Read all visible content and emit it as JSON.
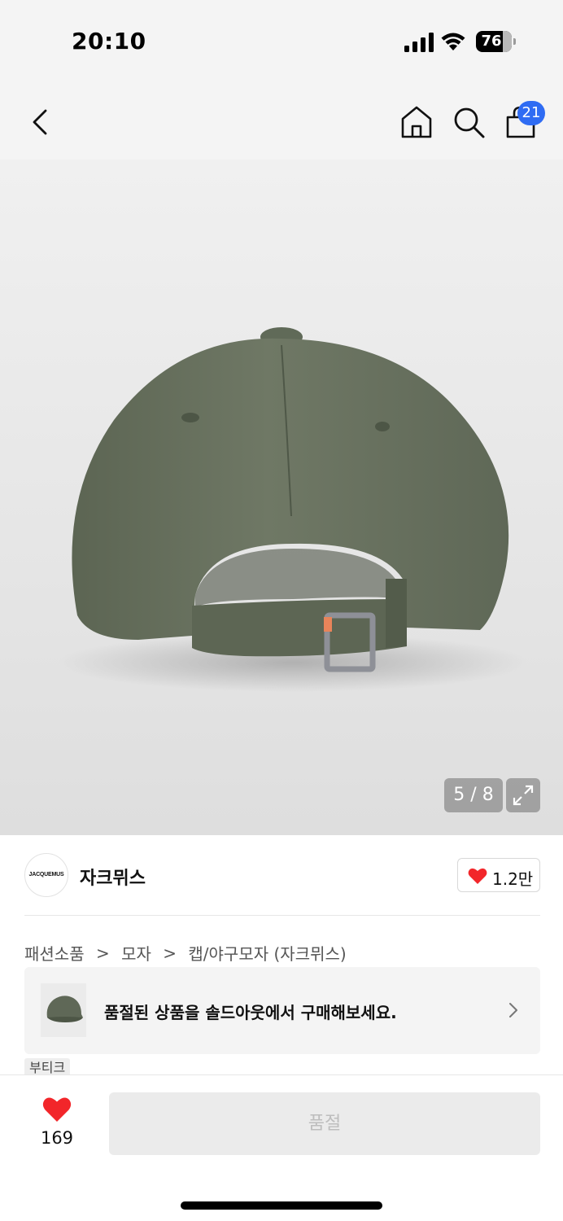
{
  "status_bar": {
    "time": "20:10",
    "battery": "76",
    "battery_level": 0.76
  },
  "header": {
    "back_icon": "chevron-left-icon",
    "home_icon": "home-icon",
    "search_icon": "search-icon",
    "cart_icon": "shopping-bag-icon",
    "cart_badge": "21",
    "badge_color": "#2f6cf3"
  },
  "gallery": {
    "counter": "5 / 8",
    "expand_icon": "expand-icon",
    "product_image": "olive-green baseball cap back view"
  },
  "brand": {
    "logo_text": "JACQUEMUS",
    "name": "자크뮈스",
    "like_count": "1.2만"
  },
  "breadcrumb": {
    "items": [
      "패션소품",
      "모자",
      "캡/야구모자 (자크뮈스)"
    ],
    "separator": ">"
  },
  "soldout_banner": {
    "text": "품절된 상품을 솔드아웃에서 구매해보세요.",
    "chevron_icon": "chevron-right-icon"
  },
  "tags": {
    "boutique": "부티크"
  },
  "bottom_bar": {
    "wish_count": "169",
    "button_label": "품절",
    "heart_color": "#f2262a"
  }
}
